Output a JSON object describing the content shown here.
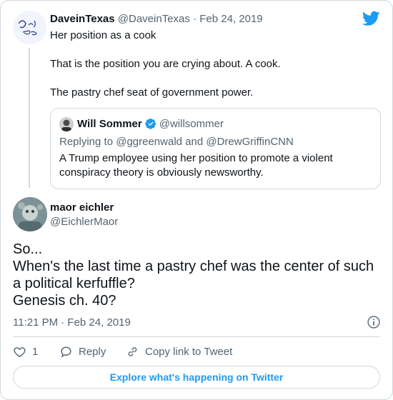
{
  "parent_tweet": {
    "avatar_label": "Dave in Texas",
    "display_name": "DaveinTexas",
    "handle": "@DaveinTexas",
    "separator": "·",
    "date": "Feb 24, 2019",
    "lines": [
      "Her position as a cook",
      "That is the position you are crying about. A cook.",
      "The pastry chef seat of government power."
    ]
  },
  "quoted_tweet": {
    "display_name": "Will Sommer",
    "handle": "@willsommer",
    "replying_to": "Replying to @ggreenwald and @DrewGriffinCNN",
    "text": "A Trump employee using her position to promote a violent conspiracy theory is obviously newsworthy."
  },
  "main_tweet": {
    "display_name": "maor eichler",
    "handle": "@EichlerMaor",
    "lines": [
      "So...",
      "When's the last time a pastry chef was the center of such a political kerfuffle?",
      "Genesis ch. 40?"
    ],
    "timestamp": "11:21 PM · Feb 24, 2019"
  },
  "actions": {
    "like_count": "1",
    "reply_label": "Reply",
    "copy_link_label": "Copy link to Tweet"
  },
  "explore_label": "Explore what's happening on Twitter",
  "colors": {
    "accent": "#1d9bf0",
    "muted_text": "#536471",
    "border": "#cfd9de"
  }
}
